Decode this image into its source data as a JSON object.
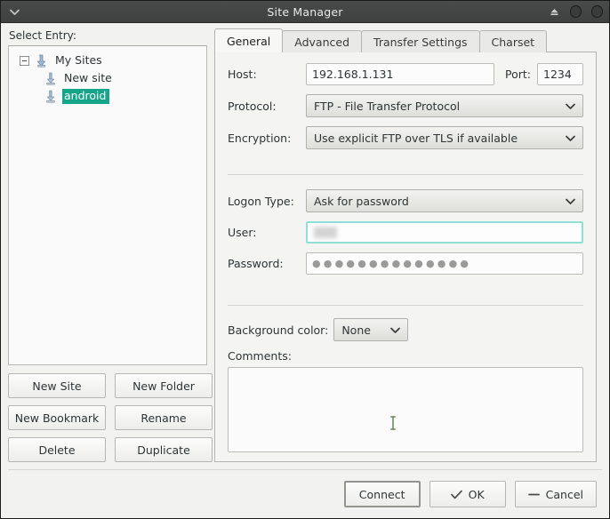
{
  "window": {
    "title": "Site Manager",
    "titlebar_icons": {
      "menu": "chevron-down-icon",
      "shade": "eject-icon",
      "maximize": "circle-icon",
      "close": "circle-icon"
    }
  },
  "left_pane": {
    "label": "Select Entry:",
    "tree": [
      {
        "label": "My Sites",
        "icon": "my-sites-icon",
        "level": 0,
        "expanded": true,
        "selected": false
      },
      {
        "label": "New site",
        "icon": "site-icon",
        "level": 1,
        "expanded": false,
        "selected": false
      },
      {
        "label": "android",
        "icon": "site-icon",
        "level": 1,
        "expanded": false,
        "selected": true
      }
    ],
    "buttons": [
      {
        "label": "New Site",
        "name": "new-site-button"
      },
      {
        "label": "New Folder",
        "name": "new-folder-button"
      },
      {
        "label": "New Bookmark",
        "name": "new-bookmark-button"
      },
      {
        "label": "Rename",
        "name": "rename-button"
      },
      {
        "label": "Delete",
        "name": "delete-button"
      },
      {
        "label": "Duplicate",
        "name": "duplicate-button"
      }
    ]
  },
  "tabs": [
    {
      "label": "General",
      "active": true
    },
    {
      "label": "Advanced",
      "active": false
    },
    {
      "label": "Transfer Settings",
      "active": false
    },
    {
      "label": "Charset",
      "active": false
    }
  ],
  "general": {
    "host_label": "Host:",
    "host_value": "192.168.1.131",
    "port_label": "Port:",
    "port_value": "1234",
    "protocol_label": "Protocol:",
    "protocol_value": "FTP - File Transfer Protocol",
    "encryption_label": "Encryption:",
    "encryption_value": "Use explicit FTP over TLS if available",
    "logon_type_label": "Logon Type:",
    "logon_type_value": "Ask for password",
    "user_label": "User:",
    "user_value": "",
    "password_label": "Password:",
    "password_value": "●●●●●●●●●●●●●●",
    "background_color_label": "Background color:",
    "background_color_value": "None",
    "comments_label": "Comments:",
    "comments_value": ""
  },
  "actions": [
    {
      "label": "Connect",
      "name": "connect-button",
      "glyph": "",
      "default": true
    },
    {
      "label": "OK",
      "name": "ok-button",
      "glyph": "check-icon",
      "default": false
    },
    {
      "label": "Cancel",
      "name": "cancel-button",
      "glyph": "minus-icon",
      "default": false
    }
  ],
  "colors": {
    "selection": "#17a589",
    "focus_border": "#8fdfd6",
    "titlebar": "#454746",
    "panel": "#f4f4f2"
  }
}
